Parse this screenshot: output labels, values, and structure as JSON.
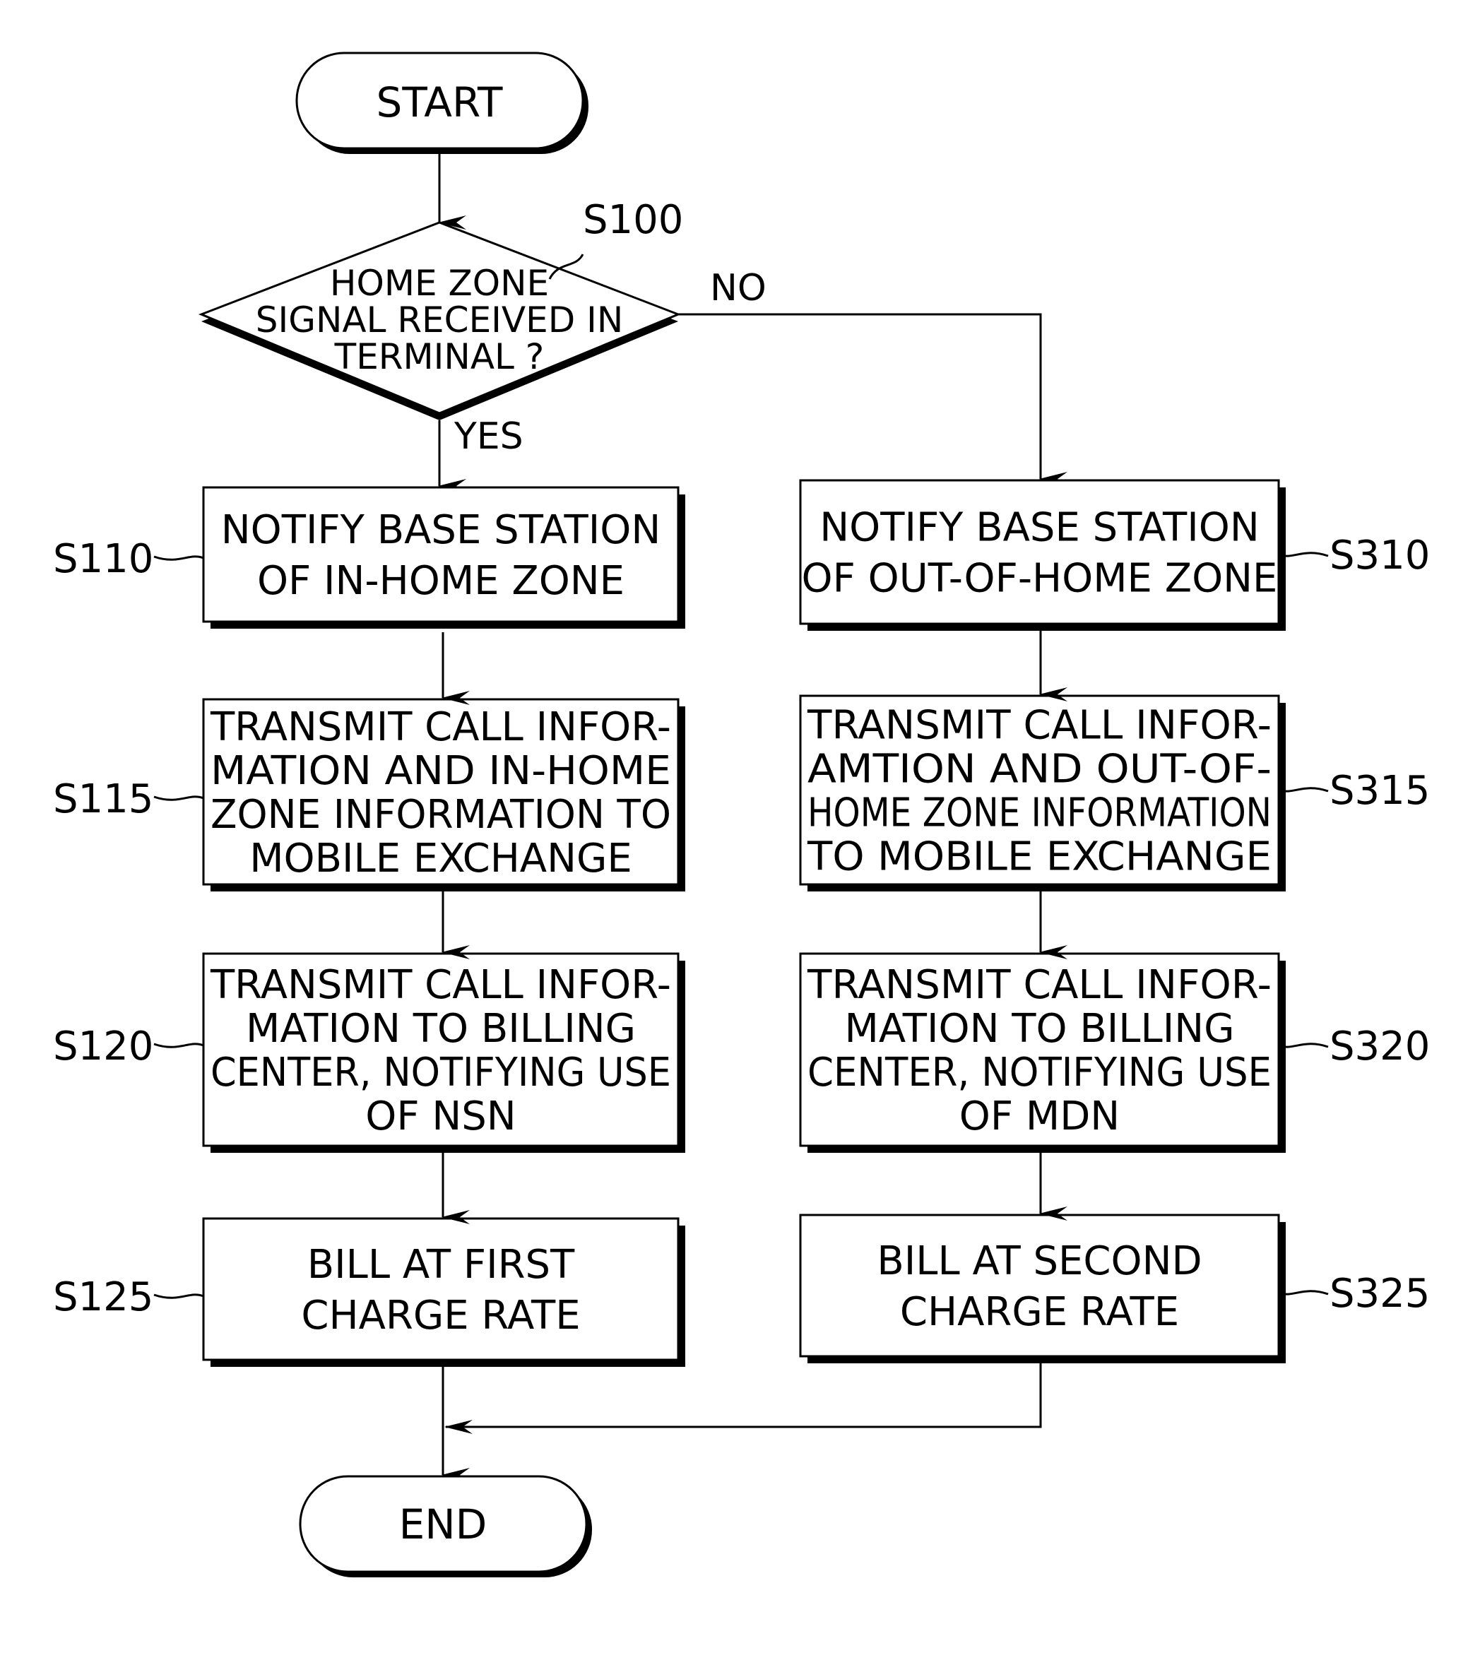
{
  "diagram": {
    "type": "flowchart",
    "start": {
      "label": "START"
    },
    "end": {
      "label": "END"
    },
    "decision": {
      "id": "S100",
      "lines": [
        "HOME ZONE",
        "SIGNAL RECEIVED IN",
        "TERMINAL ?"
      ],
      "yes_label": "YES",
      "no_label": "NO"
    },
    "left_branch": [
      {
        "id": "S110",
        "lines": [
          "NOTIFY BASE STATION",
          "OF IN-HOME ZONE"
        ]
      },
      {
        "id": "S115",
        "lines": [
          "TRANSMIT CALL INFOR-",
          "MATION AND IN-HOME",
          "ZONE INFORMATION TO",
          "MOBILE EXCHANGE"
        ]
      },
      {
        "id": "S120",
        "lines": [
          "TRANSMIT CALL INFOR-",
          "MATION TO BILLING",
          "CENTER, NOTIFYING  USE",
          "OF NSN"
        ]
      },
      {
        "id": "S125",
        "lines": [
          "BILL AT FIRST",
          "CHARGE RATE"
        ]
      }
    ],
    "right_branch": [
      {
        "id": "S310",
        "lines": [
          "NOTIFY BASE STATION",
          "OF OUT-OF-HOME ZONE"
        ]
      },
      {
        "id": "S315",
        "lines": [
          "TRANSMIT CALL INFOR-",
          "AMTION AND OUT-OF-",
          "HOME ZONE INFORMATION",
          "TO MOBILE EXCHANGE"
        ]
      },
      {
        "id": "S320",
        "lines": [
          "TRANSMIT CALL INFOR-",
          "MATION TO BILLING",
          "CENTER, NOTIFYING USE",
          "OF MDN"
        ]
      },
      {
        "id": "S325",
        "lines": [
          "BILL AT SECOND",
          "CHARGE RATE"
        ]
      }
    ]
  }
}
